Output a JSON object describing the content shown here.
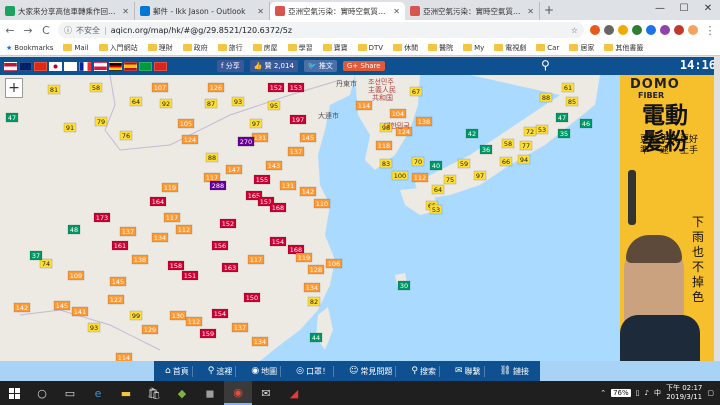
{
  "browser": {
    "tabs": [
      {
        "title": "大家來分享高信車轉乘作回好碼",
        "color": "#1aa260",
        "active": false
      },
      {
        "title": "郵件 - Ikk Jason - Outlook",
        "color": "#0078d4",
        "active": false
      },
      {
        "title": "亞洲空氣污染：實時空氣質量指數",
        "color": "#d9534f",
        "active": true
      },
      {
        "title": "亞洲空氣污染：實時空氣質量指數",
        "color": "#d9534f",
        "active": false
      }
    ],
    "new_tab": "+",
    "window_controls": [
      "—",
      "☐",
      "✕"
    ],
    "back": "←",
    "forward": "→",
    "reload": "C",
    "insecure_label": "不安全",
    "separator": "|",
    "url": "aqicn.org/map/hk/#@g/29.8521/120.6372/5z",
    "bookmarks": [
      "Bookmarks",
      "Mail",
      "入門網站",
      "理財",
      "政府",
      "旅行",
      "房屋",
      "學習",
      "寶寶",
      "DTV",
      "休閒",
      "醫院",
      "My",
      "電視劇",
      "Car",
      "居家",
      "其他書籤"
    ]
  },
  "site": {
    "share_label": "f 分享",
    "like_label": "👍 贊 2,014",
    "tweet_label": "🐦 推文",
    "gplus_label": "G+ Share",
    "time": "14:16"
  },
  "map": {
    "zoom_label": "+",
    "places": [
      "丹東市",
      "大連市",
      "조선민주",
      "主義人民",
      "共和国",
      "대한민국"
    ]
  },
  "ad": {
    "brand": "DOMO",
    "brand_sub": "FIBER",
    "headline": "電動髮粉",
    "sub_left": "更精準",
    "sub_mid": "更快速",
    "sub_right": "更好上手",
    "tagline": "下雨也不掉色"
  },
  "bottom_nav": [
    {
      "icon": "⌂",
      "label": "首頁"
    },
    {
      "icon": "⚲",
      "label": "這裡"
    },
    {
      "icon": "◉",
      "label": "地圖"
    },
    {
      "icon": "◎",
      "label": "口罩！"
    },
    {
      "icon": "☺",
      "label": "常見問題"
    },
    {
      "icon": "⚲",
      "label": "搜索"
    },
    {
      "icon": "✉",
      "label": "聯繫"
    },
    {
      "icon": "⛓",
      "label": "鏈接"
    }
  ],
  "taskbar": {
    "battery": "76%",
    "time": "下午 02:17",
    "date": "2019/3/11"
  },
  "aqi_colors": {
    "good": "#009966",
    "moderate": "#ffde33",
    "sensitive": "#ff9933",
    "unhealthy": "#cc0033",
    "very_unhealthy": "#660099"
  },
  "stations": [
    {
      "v": "81",
      "c": "moderate"
    },
    {
      "v": "58",
      "c": "moderate"
    },
    {
      "v": "91",
      "c": "moderate"
    },
    {
      "v": "79",
      "c": "moderate"
    },
    {
      "v": "107",
      "c": "sensitive"
    },
    {
      "v": "64",
      "c": "moderate"
    },
    {
      "v": "76",
      "c": "moderate"
    },
    {
      "v": "92",
      "c": "moderate"
    },
    {
      "v": "87",
      "c": "moderate"
    },
    {
      "v": "126",
      "c": "sensitive"
    },
    {
      "v": "93",
      "c": "moderate"
    },
    {
      "v": "95",
      "c": "moderate"
    },
    {
      "v": "124",
      "c": "sensitive"
    },
    {
      "v": "105",
      "c": "sensitive"
    },
    {
      "v": "152",
      "c": "unhealthy"
    },
    {
      "v": "97",
      "c": "moderate"
    },
    {
      "v": "131",
      "c": "sensitive"
    },
    {
      "v": "153",
      "c": "unhealthy"
    },
    {
      "v": "197",
      "c": "unhealthy"
    },
    {
      "v": "145",
      "c": "sensitive"
    },
    {
      "v": "114",
      "c": "sensitive"
    },
    {
      "v": "270",
      "c": "very_unhealthy"
    },
    {
      "v": "137",
      "c": "sensitive"
    },
    {
      "v": "143",
      "c": "sensitive"
    },
    {
      "v": "155",
      "c": "unhealthy"
    },
    {
      "v": "165",
      "c": "unhealthy"
    },
    {
      "v": "151",
      "c": "unhealthy"
    },
    {
      "v": "88",
      "c": "moderate"
    },
    {
      "v": "117",
      "c": "sensitive"
    },
    {
      "v": "147",
      "c": "sensitive"
    },
    {
      "v": "131",
      "c": "sensitive"
    },
    {
      "v": "168",
      "c": "unhealthy"
    },
    {
      "v": "288",
      "c": "very_unhealthy"
    },
    {
      "v": "119",
      "c": "sensitive"
    },
    {
      "v": "164",
      "c": "unhealthy"
    },
    {
      "v": "117",
      "c": "sensitive"
    },
    {
      "v": "112",
      "c": "sensitive"
    },
    {
      "v": "142",
      "c": "sensitive"
    },
    {
      "v": "110",
      "c": "sensitive"
    },
    {
      "v": "173",
      "c": "unhealthy"
    },
    {
      "v": "137",
      "c": "sensitive"
    },
    {
      "v": "134",
      "c": "sensitive"
    },
    {
      "v": "152",
      "c": "unhealthy"
    },
    {
      "v": "156",
      "c": "unhealthy"
    },
    {
      "v": "161",
      "c": "unhealthy"
    },
    {
      "v": "138",
      "c": "sensitive"
    },
    {
      "v": "158",
      "c": "unhealthy"
    },
    {
      "v": "151",
      "c": "unhealthy"
    },
    {
      "v": "163",
      "c": "unhealthy"
    },
    {
      "v": "117",
      "c": "sensitive"
    },
    {
      "v": "154",
      "c": "unhealthy"
    },
    {
      "v": "168",
      "c": "unhealthy"
    },
    {
      "v": "74",
      "c": "moderate"
    },
    {
      "v": "109",
      "c": "sensitive"
    },
    {
      "v": "145",
      "c": "sensitive"
    },
    {
      "v": "99",
      "c": "moderate"
    },
    {
      "v": "130",
      "c": "sensitive"
    },
    {
      "v": "129",
      "c": "sensitive"
    },
    {
      "v": "112",
      "c": "sensitive"
    },
    {
      "v": "93",
      "c": "moderate"
    },
    {
      "v": "122",
      "c": "sensitive"
    },
    {
      "v": "145",
      "c": "sensitive"
    },
    {
      "v": "141",
      "c": "sensitive"
    },
    {
      "v": "114",
      "c": "sensitive"
    },
    {
      "v": "159",
      "c": "unhealthy"
    },
    {
      "v": "154",
      "c": "unhealthy"
    },
    {
      "v": "150",
      "c": "unhealthy"
    },
    {
      "v": "137",
      "c": "sensitive"
    },
    {
      "v": "134",
      "c": "sensitive"
    },
    {
      "v": "119",
      "c": "sensitive"
    },
    {
      "v": "128",
      "c": "sensitive"
    },
    {
      "v": "134",
      "c": "sensitive"
    },
    {
      "v": "106",
      "c": "sensitive"
    },
    {
      "v": "82",
      "c": "moderate"
    },
    {
      "v": "47",
      "c": "good"
    },
    {
      "v": "142",
      "c": "sensitive"
    },
    {
      "v": "48",
      "c": "good"
    },
    {
      "v": "37",
      "c": "good"
    },
    {
      "v": "44",
      "c": "good"
    },
    {
      "v": "30",
      "c": "good"
    },
    {
      "v": "114",
      "c": "sensitive"
    },
    {
      "v": "104",
      "c": "sensitive"
    },
    {
      "v": "98",
      "c": "moderate"
    },
    {
      "v": "124",
      "c": "sensitive"
    },
    {
      "v": "138",
      "c": "sensitive"
    },
    {
      "v": "118",
      "c": "sensitive"
    },
    {
      "v": "83",
      "c": "moderate"
    },
    {
      "v": "100",
      "c": "moderate"
    },
    {
      "v": "112",
      "c": "sensitive"
    },
    {
      "v": "70",
      "c": "moderate"
    },
    {
      "v": "64",
      "c": "moderate"
    },
    {
      "v": "65",
      "c": "moderate"
    },
    {
      "v": "53",
      "c": "moderate"
    },
    {
      "v": "42",
      "c": "good"
    },
    {
      "v": "59",
      "c": "moderate"
    },
    {
      "v": "75",
      "c": "moderate"
    },
    {
      "v": "97",
      "c": "moderate"
    },
    {
      "v": "66",
      "c": "moderate"
    },
    {
      "v": "94",
      "c": "moderate"
    },
    {
      "v": "53",
      "c": "moderate"
    },
    {
      "v": "47",
      "c": "good"
    },
    {
      "v": "35",
      "c": "good"
    },
    {
      "v": "46",
      "c": "good"
    },
    {
      "v": "61",
      "c": "moderate"
    },
    {
      "v": "88",
      "c": "moderate"
    },
    {
      "v": "85",
      "c": "moderate"
    },
    {
      "v": "77",
      "c": "moderate"
    },
    {
      "v": "72",
      "c": "moderate"
    },
    {
      "v": "58",
      "c": "moderate"
    },
    {
      "v": "36",
      "c": "good"
    },
    {
      "v": "40",
      "c": "good"
    },
    {
      "v": "67",
      "c": "moderate"
    }
  ]
}
